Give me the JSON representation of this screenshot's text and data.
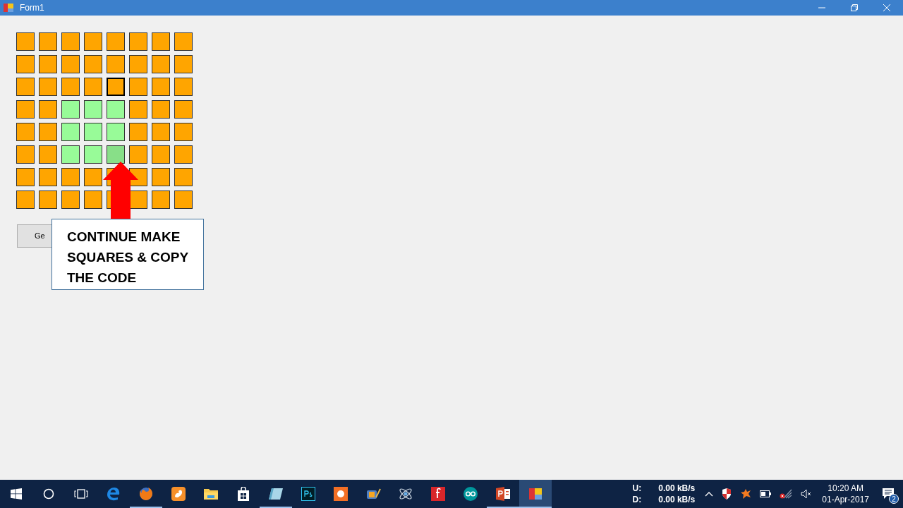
{
  "window": {
    "title": "Form1"
  },
  "grid": {
    "rows": [
      {
        "cells": [
          {
            "color": "#ffa500",
            "focused": false
          },
          {
            "color": "#ffa500",
            "focused": false
          },
          {
            "color": "#ffa500",
            "focused": false
          },
          {
            "color": "#ffa500",
            "focused": false
          },
          {
            "color": "#ffa500",
            "focused": false
          },
          {
            "color": "#ffa500",
            "focused": false
          },
          {
            "color": "#ffa500",
            "focused": false
          },
          {
            "color": "#ffa500",
            "focused": false
          }
        ]
      },
      {
        "cells": [
          {
            "color": "#ffa500",
            "focused": false
          },
          {
            "color": "#ffa500",
            "focused": false
          },
          {
            "color": "#ffa500",
            "focused": false
          },
          {
            "color": "#ffa500",
            "focused": false
          },
          {
            "color": "#ffa500",
            "focused": false
          },
          {
            "color": "#ffa500",
            "focused": false
          },
          {
            "color": "#ffa500",
            "focused": false
          },
          {
            "color": "#ffa500",
            "focused": false
          }
        ]
      },
      {
        "cells": [
          {
            "color": "#ffa500",
            "focused": false
          },
          {
            "color": "#ffa500",
            "focused": false
          },
          {
            "color": "#ffa500",
            "focused": false
          },
          {
            "color": "#ffa500",
            "focused": false
          },
          {
            "color": "#ffa500",
            "focused": true
          },
          {
            "color": "#ffa500",
            "focused": false
          },
          {
            "color": "#ffa500",
            "focused": false
          },
          {
            "color": "#ffa500",
            "focused": false
          }
        ]
      },
      {
        "cells": [
          {
            "color": "#ffa500",
            "focused": false
          },
          {
            "color": "#ffa500",
            "focused": false
          },
          {
            "color": "#98fb98",
            "focused": false
          },
          {
            "color": "#98fb98",
            "focused": false
          },
          {
            "color": "#98fb98",
            "focused": false
          },
          {
            "color": "#ffa500",
            "focused": false
          },
          {
            "color": "#ffa500",
            "focused": false
          },
          {
            "color": "#ffa500",
            "focused": false
          }
        ]
      },
      {
        "cells": [
          {
            "color": "#ffa500",
            "focused": false
          },
          {
            "color": "#ffa500",
            "focused": false
          },
          {
            "color": "#98fb98",
            "focused": false
          },
          {
            "color": "#98fb98",
            "focused": false
          },
          {
            "color": "#98fb98",
            "focused": false
          },
          {
            "color": "#ffa500",
            "focused": false
          },
          {
            "color": "#ffa500",
            "focused": false
          },
          {
            "color": "#ffa500",
            "focused": false
          }
        ]
      },
      {
        "cells": [
          {
            "color": "#ffa500",
            "focused": false
          },
          {
            "color": "#ffa500",
            "focused": false
          },
          {
            "color": "#98fb98",
            "focused": false
          },
          {
            "color": "#98fb98",
            "focused": false
          },
          {
            "color": "#88df88",
            "focused": false
          },
          {
            "color": "#ffa500",
            "focused": false
          },
          {
            "color": "#ffa500",
            "focused": false
          },
          {
            "color": "#ffa500",
            "focused": false
          }
        ]
      },
      {
        "cells": [
          {
            "color": "#ffa500",
            "focused": false
          },
          {
            "color": "#ffa500",
            "focused": false
          },
          {
            "color": "#ffa500",
            "focused": false
          },
          {
            "color": "#ffa500",
            "focused": false
          },
          {
            "color": "#ffa500",
            "focused": false
          },
          {
            "color": "#ffa500",
            "focused": false
          },
          {
            "color": "#ffa500",
            "focused": false
          },
          {
            "color": "#ffa500",
            "focused": false
          }
        ]
      },
      {
        "cells": [
          {
            "color": "#ffa500",
            "focused": false
          },
          {
            "color": "#ffa500",
            "focused": false
          },
          {
            "color": "#ffa500",
            "focused": false
          },
          {
            "color": "#ffa500",
            "focused": false
          },
          {
            "color": "#ffa500",
            "focused": false
          },
          {
            "color": "#ffa500",
            "focused": false
          },
          {
            "color": "#ffa500",
            "focused": false
          },
          {
            "color": "#ffa500",
            "focused": false
          }
        ]
      }
    ]
  },
  "button": {
    "label": "Ge"
  },
  "callout": {
    "text": "CONTINUE MAKE SQUARES & COPY THE CODE"
  },
  "taskbar": {
    "items": [
      {
        "kind": "start",
        "running": false,
        "active": false
      },
      {
        "kind": "search",
        "running": false,
        "active": false
      },
      {
        "kind": "taskview",
        "running": false,
        "active": false
      },
      {
        "kind": "edge",
        "running": false,
        "active": false
      },
      {
        "kind": "firefox",
        "running": true,
        "active": false
      },
      {
        "kind": "uc",
        "running": false,
        "active": false
      },
      {
        "kind": "folder",
        "running": false,
        "active": false
      },
      {
        "kind": "store",
        "running": false,
        "active": false
      },
      {
        "kind": "notepad",
        "running": true,
        "active": false
      },
      {
        "kind": "ps",
        "running": false,
        "active": false
      },
      {
        "kind": "orange",
        "running": false,
        "active": false
      },
      {
        "kind": "movie",
        "running": false,
        "active": false
      },
      {
        "kind": "atom",
        "running": false,
        "active": false
      },
      {
        "kind": "redf",
        "running": false,
        "active": false
      },
      {
        "kind": "arduino",
        "running": false,
        "active": false
      },
      {
        "kind": "ppt",
        "running": true,
        "active": false
      },
      {
        "kind": "form",
        "running": true,
        "active": true
      }
    ]
  },
  "tray": {
    "upload_label": "U:",
    "download_label": "D:",
    "upload_speed": "0.00 kB/s",
    "download_speed": "0.00 kB/s",
    "time": "10:20 AM",
    "date": "01-Apr-2017",
    "notifications": "2"
  }
}
